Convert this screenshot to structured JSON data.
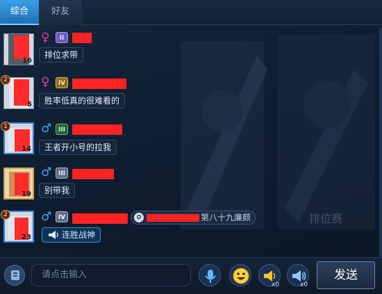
{
  "tabs": [
    {
      "label": "综合",
      "active": true
    },
    {
      "label": "好友",
      "active": false
    }
  ],
  "messages": [
    {
      "level": "16",
      "rank_num": "",
      "gender": "♀",
      "tier": "II",
      "text": "排位求带"
    },
    {
      "level": "5",
      "rank_num": "2",
      "gender": "♀",
      "tier": "IV",
      "text": "胜率低真的很难看的"
    },
    {
      "level": "14",
      "rank_num": "1",
      "gender": "♂",
      "tier": "III",
      "text": "王者开小号的拉我"
    },
    {
      "level": "19",
      "rank_num": "",
      "gender": "♂",
      "tier": "III",
      "text": "别带我"
    },
    {
      "level": "23",
      "rank_num": "2",
      "gender": "♂",
      "tier": "IV",
      "text": "连胜战神",
      "title_chip": "第八十九廉颇"
    }
  ],
  "background_text": {
    "mode": "排位赛"
  },
  "input": {
    "placeholder": "请点击输入"
  },
  "buttons": {
    "send": "发送",
    "horn_small_count": "x0",
    "horn_big_count": "x0"
  },
  "colors": {
    "accent": "#2f8fe0",
    "redaction": "#ff2424",
    "female": "#e93ab8",
    "male": "#3ea8f0"
  },
  "icons": [
    "voice-toggle-icon",
    "microphone-icon",
    "emoji-icon",
    "small-horn-icon",
    "big-horn-icon"
  ]
}
